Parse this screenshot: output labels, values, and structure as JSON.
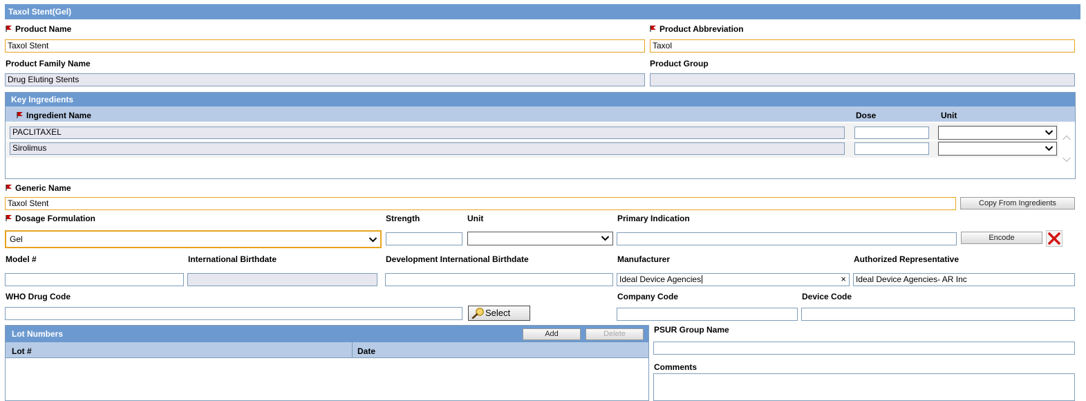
{
  "title": "Taxol Stent(Gel)",
  "product_name": {
    "label": "Product Name",
    "value": "Taxol Stent"
  },
  "product_abbreviation": {
    "label": "Product Abbreviation",
    "value": "Taxol"
  },
  "product_family_name": {
    "label": "Product Family Name",
    "value": "Drug Eluting Stents"
  },
  "product_group": {
    "label": "Product Group",
    "value": ""
  },
  "key_ingredients": {
    "title": "Key Ingredients",
    "columns": {
      "ingredient_name": "Ingredient Name",
      "dose": "Dose",
      "unit": "Unit"
    },
    "rows": [
      {
        "ingredient": "PACLITAXEL",
        "dose": "",
        "unit": ""
      },
      {
        "ingredient": "Sirolimus",
        "dose": "",
        "unit": ""
      }
    ]
  },
  "generic_name": {
    "label": "Generic Name",
    "value": "Taxol Stent",
    "copy_button": "Copy From Ingredients"
  },
  "dosage_formulation": {
    "label": "Dosage Formulation",
    "value": "Gel"
  },
  "strength": {
    "label": "Strength",
    "value": ""
  },
  "unit": {
    "label": "Unit",
    "value": ""
  },
  "primary_indication": {
    "label": "Primary Indication",
    "value": "",
    "encode_button": "Encode"
  },
  "model_number": {
    "label": "Model #",
    "value": ""
  },
  "international_birthdate": {
    "label": "International Birthdate",
    "value": ""
  },
  "development_international_birthdate": {
    "label": "Development International Birthdate",
    "value": ""
  },
  "manufacturer": {
    "label": "Manufacturer",
    "value": "Ideal Device Agencies",
    "clear_glyph": "×"
  },
  "authorized_representative": {
    "label": "Authorized Representative",
    "value": "Ideal Device Agencies- AR Inc"
  },
  "who_drug_code": {
    "label": "WHO Drug Code",
    "value": "",
    "select_button": "Select"
  },
  "company_code": {
    "label": "Company Code",
    "value": ""
  },
  "device_code": {
    "label": "Device Code",
    "value": ""
  },
  "lot_numbers": {
    "title": "Lot Numbers",
    "add_button": "Add",
    "delete_button": "Delete",
    "columns": {
      "lot": "Lot #",
      "date": "Date"
    }
  },
  "psur_group_name": {
    "label": "PSUR Group Name",
    "value": ""
  },
  "comments": {
    "label": "Comments",
    "value": ""
  },
  "icons": {
    "required": "red-flag-icon",
    "delete": "red-x-icon",
    "search": "magnifier-icon",
    "dropdown": "chevron-down-icon"
  },
  "colors": {
    "header": "#6c9ad0",
    "subheader": "#b7cbe6",
    "readonly": "#e7e7f0",
    "required_border": "#e8a21d",
    "field_border": "#7f9db9"
  }
}
